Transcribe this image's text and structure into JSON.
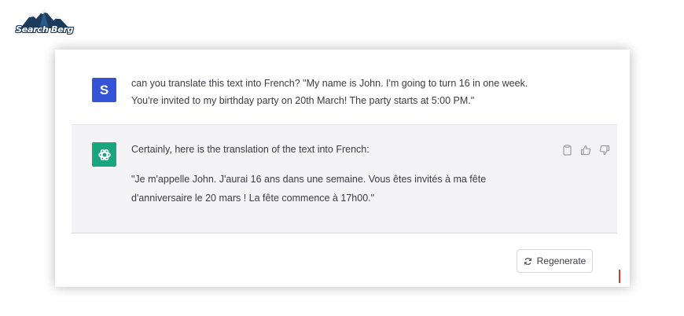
{
  "logo": {
    "text": "Search Berg"
  },
  "conversation": {
    "user": {
      "avatar_letter": "S",
      "message_line1": "can you translate this text into French? \"My name is John. I'm going to turn 16 in one week.",
      "message_line2": "You're invited to my birthday party on 20th March! The party starts at 5:00 PM.\""
    },
    "assistant": {
      "avatar_icon": "openai-logo-icon",
      "intro": "Certainly, here is the translation of the text into French:",
      "quote_line1": "\"Je m'appelle John. J'aurai 16 ans dans une semaine. Vous êtes invités à ma fête",
      "quote_line2": "d'anniversaire le 20 mars ! La fête commence à 17h00.\"",
      "actions": [
        "copy-icon",
        "thumbs-up-icon",
        "thumbs-down-icon"
      ]
    }
  },
  "regenerate": {
    "label": "Regenerate",
    "icon": "refresh-icon"
  },
  "colors": {
    "user_avatar": "#3553d6",
    "assistant_avatar": "#19a67e",
    "assistant_bg": "#f4f4f6",
    "cursor": "#e0312d"
  }
}
